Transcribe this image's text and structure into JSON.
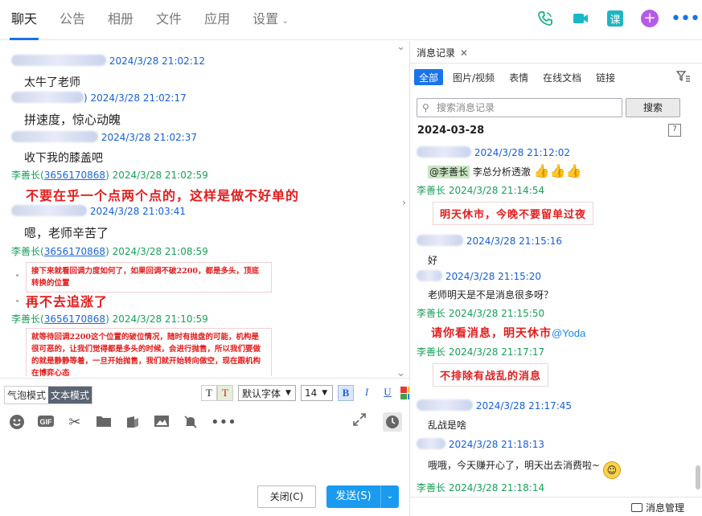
{
  "nav": {
    "tabs": [
      "聊天",
      "公告",
      "相册",
      "文件",
      "应用",
      "设置"
    ],
    "active_tab": "聊天",
    "icons": [
      "phone-icon",
      "video-icon",
      "course-icon",
      "add-icon",
      "more-icon"
    ],
    "course_label": "课"
  },
  "chat": {
    "messages": [
      {
        "time": "2024/3/28 21:02:12",
        "text": "太牛了老师"
      },
      {
        "time": "2024/3/28 21:02:17",
        "text": "拼速度，惊心动魄"
      },
      {
        "time": "2024/3/28 21:02:37",
        "text": "收下我的膝盖吧"
      },
      {
        "sender": "李善长",
        "uid": "3656170868",
        "time": "2024/3/28 21:02:59",
        "text": "不要在乎一个点两个点的，这样是做不好单的"
      },
      {
        "time": "2024/3/28 21:03:41",
        "text": "嗯，老师辛苦了"
      },
      {
        "sender": "李善长",
        "uid": "3656170868",
        "time": "2024/3/28 21:08:59",
        "text": "接下来就看回调力度如何了，如果回调不破2200，都是多头，顶底转换的位置",
        "text2": "再不去追涨了"
      },
      {
        "sender": "李善长",
        "uid": "3656170868",
        "time": "2024/3/28 21:10:59",
        "text": "就等待回调2200这个位置的破位情况，随时有抛盘的可能，机构是很可恶的，让我们觉得都是多头的时候，会进行抛售，所以我们要做的就是静静等着，一旦开始抛售，我们就开始转向做空，现在跟机构在博弈心态"
      }
    ]
  },
  "editor": {
    "mode_bubble": "气泡模式",
    "mode_text": "文本模式",
    "font": "默认字体",
    "size": "14",
    "bold": "B",
    "italic": "I",
    "underline": "U",
    "close_label": "关闭(C)",
    "send_label": "发送(S)"
  },
  "history": {
    "title": "消息记录",
    "filters": [
      "全部",
      "图片/视频",
      "表情",
      "在线文档",
      "链接"
    ],
    "active_filter": "全部",
    "search_placeholder": "搜索消息记录",
    "search_button": "搜索",
    "date": "2024-03-28",
    "entries": [
      {
        "time": "2024/3/28 21:12:02",
        "mention": "@李善长",
        "text": "李总分析透澈"
      },
      {
        "sender": "李善长",
        "time": "2024/3/28 21:14:54",
        "text": "明天休市，今晚不要留单过夜"
      },
      {
        "time": "2024/3/28 21:15:16",
        "text": "好"
      },
      {
        "time": "2024/3/28 21:15:20",
        "text": "老师明天是不是消息很多呀？"
      },
      {
        "sender": "李善长",
        "time": "2024/3/28 21:15:50",
        "text": "请你看消息，明天休市",
        "mention": "@Yoda"
      },
      {
        "sender": "李善长",
        "time": "2024/3/28 21:17:17",
        "text": "不排除有战乱的消息"
      },
      {
        "time": "2024/3/28 21:17:45",
        "text": "乱战是啥"
      },
      {
        "time": "2024/3/28 21:18:13",
        "text": "哦哦，今天赚开心了，明天出去消费啦~"
      },
      {
        "sender": "李善长",
        "time": "2024/3/28 21:18:14"
      }
    ],
    "footer": "消息管理"
  }
}
